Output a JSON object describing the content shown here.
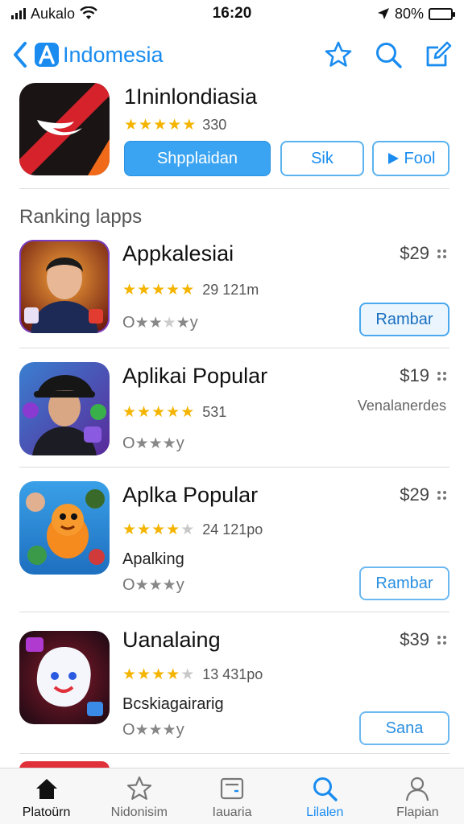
{
  "status_bar": {
    "carrier": "Aukalo",
    "time": "16:20",
    "battery": "80%",
    "battery_level": 0.8
  },
  "nav": {
    "title": "Indomesia",
    "icons": [
      "chevron-left-icon",
      "app-store-logo-icon",
      "star-icon",
      "search-icon",
      "compose-icon"
    ]
  },
  "featured": {
    "name": "1Ininlondiasia",
    "rating": 4.5,
    "rating_count": "330",
    "primary_button": "Shpplaidan",
    "secondary_button": "Sik",
    "third_button": "Fool"
  },
  "section_title": "Ranking lapps",
  "apps": [
    {
      "name": "Appkalesiai",
      "price": "$29",
      "rating": 4.5,
      "meta": "29  121m",
      "sub": "",
      "bottom_prefix": "O",
      "bottom_suffix": "y",
      "button": "Rambar",
      "button_style": "filled",
      "note": ""
    },
    {
      "name": "Aplikai Popular",
      "price": "$19",
      "rating": 4.5,
      "meta": "531",
      "sub": "",
      "bottom_prefix": "O",
      "bottom_suffix": "y",
      "button": "",
      "button_style": "",
      "note": "Venalanerdes"
    },
    {
      "name": "Aplka Popular",
      "price": "$29",
      "rating": 4.0,
      "meta": "24  121po",
      "sub": "Apalking",
      "bottom_prefix": "O",
      "bottom_suffix": "y",
      "button": "Rambar",
      "button_style": "outline",
      "note": ""
    },
    {
      "name": "Uanalaing",
      "price": "$39",
      "rating": 3.5,
      "meta": "13  431po",
      "sub": "Bcskiagairarig",
      "bottom_prefix": "O",
      "bottom_suffix": "y",
      "button": "Sana",
      "button_style": "outline",
      "note": ""
    }
  ],
  "tabs": [
    {
      "label": "Platoürn",
      "icon": "home-icon"
    },
    {
      "label": "Nidonisim",
      "icon": "star-icon"
    },
    {
      "label": "Iauaria",
      "icon": "card-icon"
    },
    {
      "label": "Lilalen",
      "icon": "search-icon"
    },
    {
      "label": "Flapian",
      "icon": "person-icon"
    }
  ],
  "colors": {
    "accent": "#1a8cf0",
    "star": "#f4b400"
  }
}
